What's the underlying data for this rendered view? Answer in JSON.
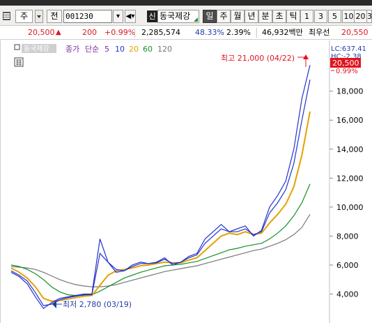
{
  "toolbar": {
    "market_label": "주",
    "jeon_label": "전",
    "code": "001230",
    "sin_label": "신",
    "stock_name": "동국제강",
    "periods": [
      "일",
      "주",
      "월",
      "년",
      "분",
      "초",
      "틱"
    ],
    "active_period": "일",
    "numbers": [
      "1",
      "3",
      "5",
      "10",
      "20",
      "3"
    ]
  },
  "quote": {
    "price": "20,500",
    "change": "200",
    "change_pct": "+0.99%",
    "volume": "2,285,574",
    "vol_ratio": "48.33%",
    "turnover": "2.39%",
    "amount": "46,932백만",
    "best_ask_label": "최우선",
    "best_ask": "20,550",
    "up_color": "#e0141e"
  },
  "legend": {
    "title": "동국제강",
    "price_label": "종가",
    "ma_label": "단순",
    "ma": [
      {
        "period": "5",
        "color": "#2233cc"
      },
      {
        "period": "10",
        "color": "#2233cc"
      },
      {
        "period": "20",
        "color": "#e6a000"
      },
      {
        "period": "60",
        "color": "#14912a"
      },
      {
        "period": "120",
        "color": "#777777"
      }
    ]
  },
  "chart_data": {
    "type": "line",
    "yticks": [
      "18,000",
      "16,000",
      "14,000",
      "12,000",
      "10,000",
      "8,000",
      "6,000",
      "4,000"
    ],
    "ylim": [
      2000,
      21500
    ],
    "lc_label": "LC:637.41",
    "hc_label": "HC:-2.38",
    "current_price": "20,500",
    "current_change": "0.99%",
    "max_label": "최고 21,000 (04/22)",
    "min_label": "최저 2,780 (03/19)",
    "series": [
      {
        "name": "5",
        "color": "#2233cc",
        "values": [
          5500,
          5200,
          4700,
          3800,
          3000,
          3400,
          3700,
          3800,
          3900,
          4000,
          4000,
          7800,
          6200,
          5500,
          5600,
          6000,
          6200,
          6100,
          6200,
          6500,
          6000,
          6200,
          6600,
          6800,
          7800,
          8300,
          8800,
          8300,
          8500,
          8700,
          8000,
          8400,
          10000,
          10800,
          11800,
          14000,
          17500,
          19800
        ]
      },
      {
        "name": "10",
        "color": "#2233cc",
        "values": [
          5600,
          5300,
          4900,
          4100,
          3200,
          3300,
          3600,
          3750,
          3850,
          3950,
          3950,
          6800,
          6200,
          5700,
          5600,
          5900,
          6100,
          6100,
          6150,
          6400,
          6100,
          6200,
          6500,
          6700,
          7500,
          8000,
          8500,
          8300,
          8300,
          8500,
          8100,
          8300,
          9600,
          10300,
          11200,
          13000,
          16000,
          18800
        ]
      },
      {
        "name": "20",
        "color": "#e6a000",
        "values": [
          5800,
          5500,
          5100,
          4500,
          3700,
          3500,
          3550,
          3650,
          3750,
          3850,
          3900,
          4600,
          5300,
          5600,
          5700,
          5800,
          5950,
          6000,
          6100,
          6200,
          6150,
          6150,
          6350,
          6500,
          7000,
          7500,
          8000,
          8200,
          8100,
          8300,
          8100,
          8200,
          8900,
          9500,
          10200,
          11400,
          13600,
          16600
        ]
      },
      {
        "name": "60",
        "color": "#14912a",
        "values": [
          6000,
          5900,
          5700,
          5400,
          5000,
          4500,
          4150,
          3950,
          3900,
          3900,
          3950,
          4200,
          4500,
          4800,
          5100,
          5300,
          5500,
          5650,
          5800,
          5950,
          6000,
          6050,
          6150,
          6250,
          6450,
          6650,
          6850,
          7050,
          7150,
          7300,
          7400,
          7500,
          7800,
          8200,
          8700,
          9400,
          10300,
          11600
        ]
      },
      {
        "name": "120",
        "color": "#777777",
        "values": [
          5900,
          5850,
          5800,
          5700,
          5500,
          5250,
          5000,
          4800,
          4650,
          4550,
          4500,
          4500,
          4550,
          4650,
          4800,
          4950,
          5100,
          5250,
          5400,
          5550,
          5650,
          5750,
          5850,
          5950,
          6100,
          6250,
          6400,
          6550,
          6700,
          6850,
          7000,
          7100,
          7300,
          7500,
          7750,
          8100,
          8600,
          9500
        ]
      }
    ]
  }
}
